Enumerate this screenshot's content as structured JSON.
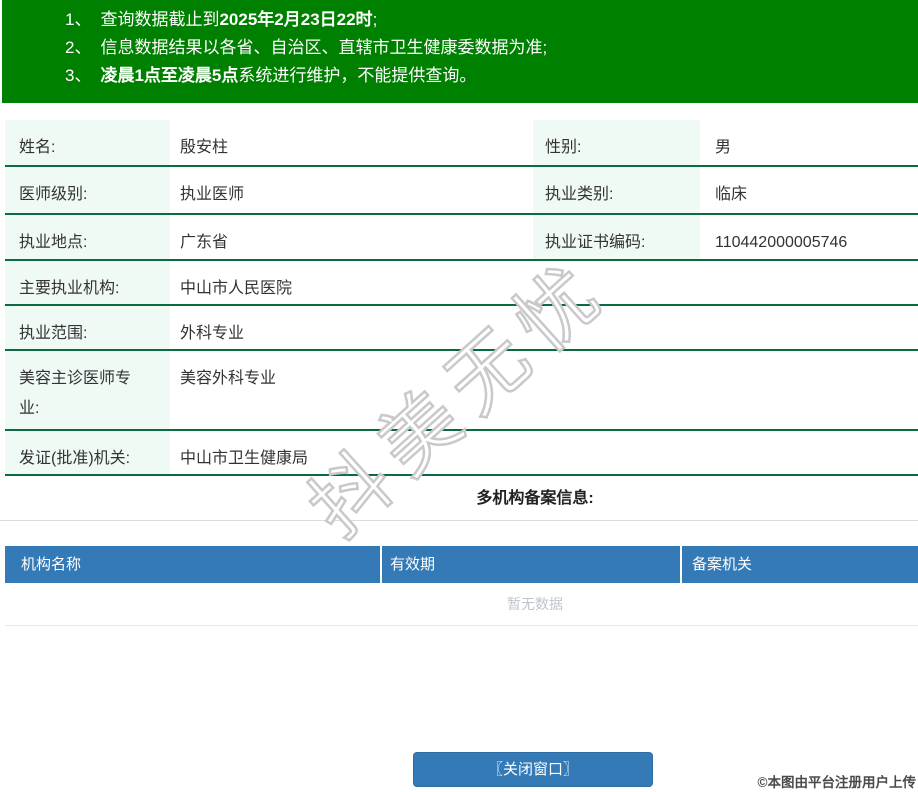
{
  "notice": {
    "line1": {
      "num": "1、",
      "pre": "查询数据截止到",
      "bold": "2025年2月23日22时",
      "post": ";"
    },
    "line2": {
      "num": "2、",
      "text": "信息数据结果以各省、自治区、直辖市卫生健康委数据为准;"
    },
    "line3": {
      "num": "3、",
      "bold": "凌晨1点至凌晨5点",
      "post": "系统进行维护，不能提供查询。"
    }
  },
  "profile": {
    "rows": [
      {
        "label": "姓名:",
        "value": "殷安柱",
        "label2": "性别:",
        "value2": "男"
      },
      {
        "label": "医师级别:",
        "value": "执业医师",
        "label2": "执业类别:",
        "value2": "临床"
      },
      {
        "label": "执业地点:",
        "value": "广东省",
        "label2": "执业证书编码:",
        "value2": "110442000005746"
      },
      {
        "label": "主要执业机构:",
        "value": "中山市人民医院"
      },
      {
        "label": "执业范围:",
        "value": "外科专业"
      },
      {
        "label": "美容主诊医师专业:",
        "value": "美容外科专业"
      },
      {
        "label": "发证(批准)机关:",
        "value": "中山市卫生健康局"
      }
    ]
  },
  "records": {
    "title": "多机构备案信息:",
    "headers": [
      "机构名称",
      "有效期",
      "备案机关"
    ],
    "empty_text": "暂无数据"
  },
  "footer": {
    "close_button": "〖关闭窗口〗",
    "credit": "©本图由平台注册用户上传"
  },
  "watermark": {
    "text": "抖美无忧"
  },
  "colors": {
    "banner_green": "#008000",
    "table_border_green": "#0a6b3f",
    "label_bg": "#effaf4",
    "accent_blue": "#337ab7",
    "empty_text_gray": "#c0c4cc"
  }
}
